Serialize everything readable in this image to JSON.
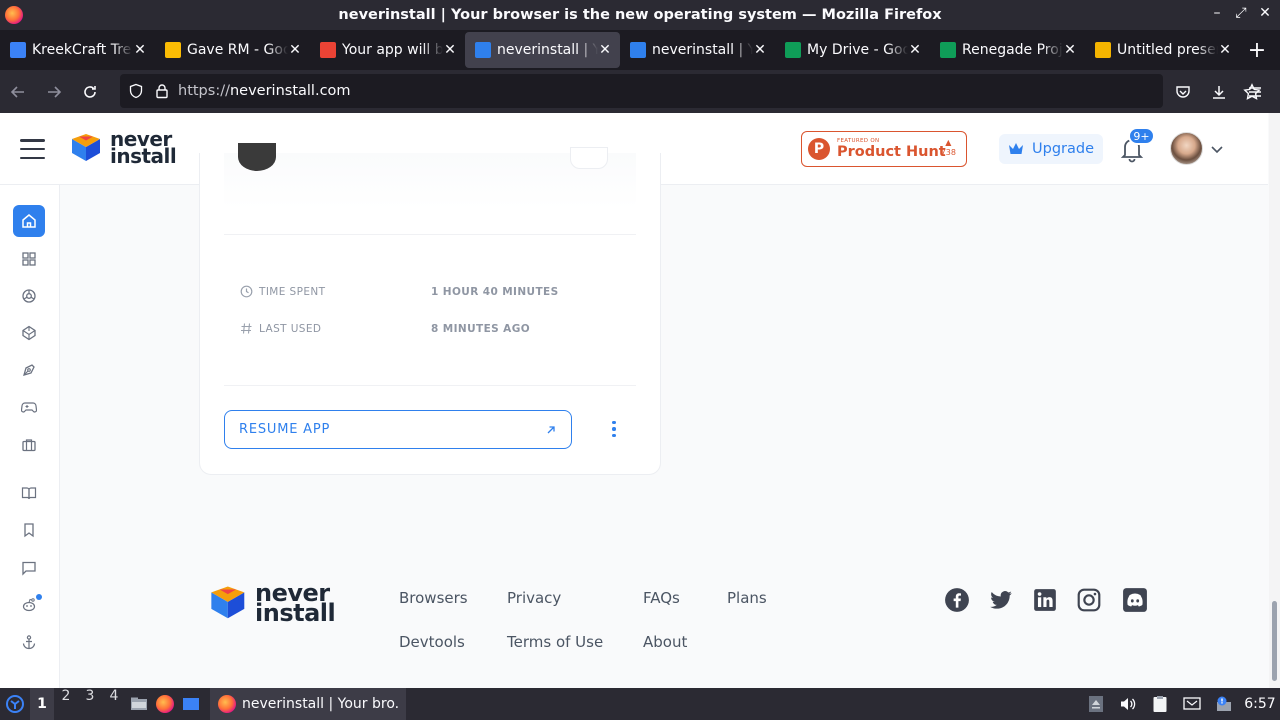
{
  "window": {
    "title": "neverinstall | Your browser is the new operating system — Mozilla Firefox"
  },
  "tabs": [
    {
      "label": "KreekCraft Tre",
      "favicon": "kreekcraft-favicon",
      "color": "#3b82f6"
    },
    {
      "label": "Gave RM - Goo",
      "favicon": "google-photos-favicon",
      "color": "#fbbc04"
    },
    {
      "label": "Your app will b",
      "favicon": "gmail-favicon",
      "color": "#ea4335"
    },
    {
      "label": "neverinstall | Y",
      "favicon": "neverinstall-favicon",
      "color": "#2f80ed",
      "active": true
    },
    {
      "label": "neverinstall | Y",
      "favicon": "neverinstall-favicon",
      "color": "#2f80ed"
    },
    {
      "label": "My Drive - Goo",
      "favicon": "google-drive-favicon",
      "color": "#0f9d58"
    },
    {
      "label": "Renegade Proj",
      "favicon": "google-sheets-favicon",
      "color": "#0f9d58"
    },
    {
      "label": "Untitled presen",
      "favicon": "google-slides-favicon",
      "color": "#f4b400"
    }
  ],
  "urlbar": {
    "protocol": "https://",
    "domain": "neverinstall.com"
  },
  "header": {
    "brand_line1": "never",
    "brand_line2": "install",
    "producthunt_small": "FEATURED ON",
    "producthunt_big": "Product Hunt",
    "producthunt_votes": "738",
    "upgrade_label": "Upgrade",
    "notif_count": "9+"
  },
  "card": {
    "time_spent_label": "TIME SPENT",
    "time_spent_value": "1 HOUR 40 MINUTES",
    "last_used_label": "LAST USED",
    "last_used_value": "8 MINUTES AGO",
    "resume_label": "RESUME APP"
  },
  "footer": {
    "brand_line1": "never",
    "brand_line2": "install",
    "links": {
      "browsers": "Browsers",
      "privacy": "Privacy",
      "faqs": "FAQs",
      "plans": "Plans",
      "devtools": "Devtools",
      "terms": "Terms of Use",
      "about": "About"
    }
  },
  "taskbar": {
    "workspaces": [
      "1",
      "2",
      "3",
      "4"
    ],
    "task_label": "neverinstall | Your bro...",
    "clock": "6:57"
  },
  "colors": {
    "accent": "#2f80ed",
    "producthunt": "#da552f"
  }
}
